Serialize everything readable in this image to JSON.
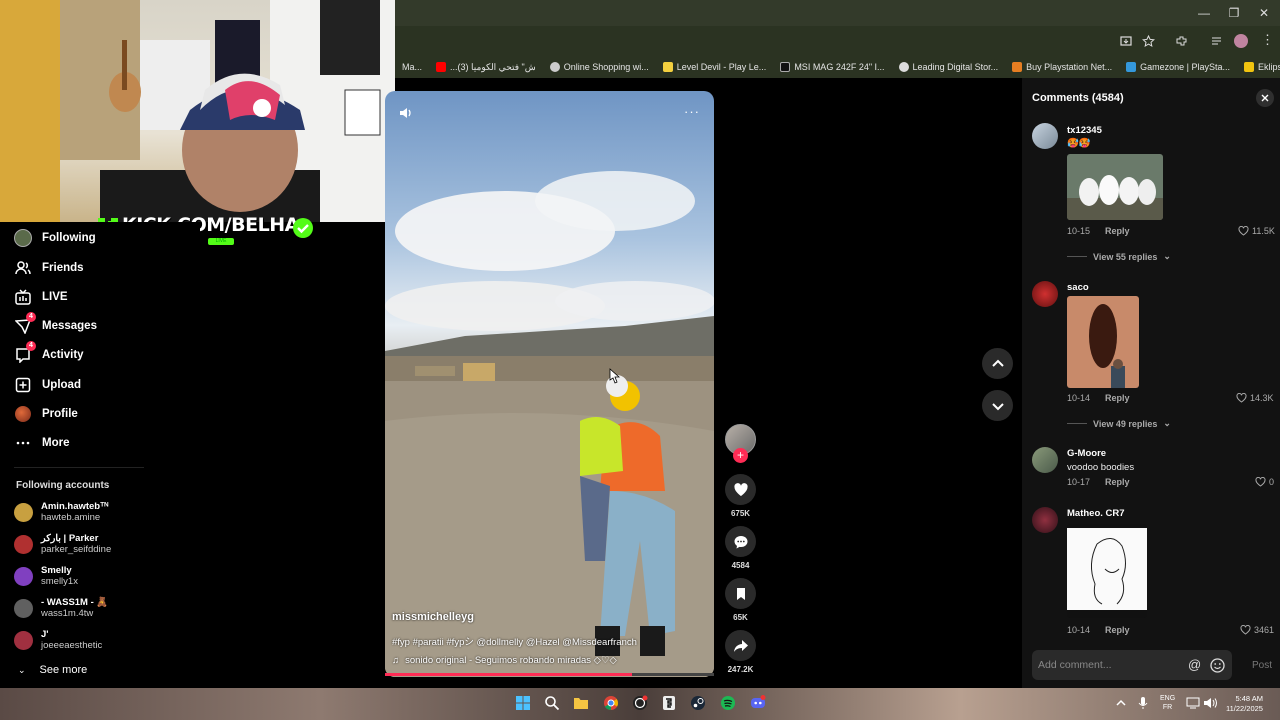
{
  "browser": {
    "bookmarks": [
      {
        "label": "Ma...",
        "color": "#888888"
      },
      {
        "label": "...ش\" فتحي الكوميا (3)",
        "color": "#ff0000"
      },
      {
        "label": "Online Shopping wi...",
        "color": "#cccccc"
      },
      {
        "label": "Level Devil - Play Le...",
        "color": "#f4d03f"
      },
      {
        "label": "MSI MAG 242F 24\" I...",
        "color": "#222222"
      },
      {
        "label": "Leading Digital Stor...",
        "color": "#dddddd"
      },
      {
        "label": "Buy Playstation Net...",
        "color": "#e67e22"
      },
      {
        "label": "Gamezone | PlaySta...",
        "color": "#3498db"
      },
      {
        "label": "Eklipse - Convert Tw...",
        "color": "#f1c40f"
      }
    ]
  },
  "stream_overlay": {
    "kick_text": "KICK.COM/BELHA",
    "live_label": "LIVE"
  },
  "sidebar": {
    "items": [
      {
        "label": "Following",
        "icon": "following-avatar-icon"
      },
      {
        "label": "Friends",
        "icon": "friends-icon"
      },
      {
        "label": "LIVE",
        "icon": "live-icon"
      },
      {
        "label": "Messages",
        "icon": "messages-icon",
        "badge": "4"
      },
      {
        "label": "Activity",
        "icon": "activity-icon",
        "badge": "4"
      },
      {
        "label": "Upload",
        "icon": "upload-icon"
      },
      {
        "label": "Profile",
        "icon": "profile-icon"
      },
      {
        "label": "More",
        "icon": "more-icon"
      }
    ],
    "following_header": "Following accounts",
    "accounts": [
      {
        "name": "Amin.hawtebᵀᴺ",
        "handle": "hawteb.amine",
        "color": "#c8a040"
      },
      {
        "name": "باركر | Parker",
        "handle": "parker_seifddine",
        "color": "#b03030"
      },
      {
        "name": "Smelly",
        "handle": "smelly1x",
        "color": "#8040c0"
      },
      {
        "name": "- WASS1M - 🧸",
        "handle": "wass1m.4tw",
        "color": "#606060"
      },
      {
        "name": "J'",
        "handle": "joeeeaesthetic",
        "color": "#a03040"
      }
    ],
    "see_more": "See more"
  },
  "video": {
    "author": "missmichelleyg",
    "caption": "#fyp #paratii #fypシ @dollmelly @Hazel @Missdearfranch",
    "music": "sonido original - Seguimos robando miradas ◇♡◇",
    "progress": 0.75,
    "actions": {
      "likes": "675K",
      "comments": "4584",
      "saves": "65K",
      "shares": "247.2K"
    }
  },
  "comments": {
    "title": "Comments (4584)",
    "items": [
      {
        "user": "tx12345",
        "text": "🥵🥵",
        "date": "10-15",
        "reply": "Reply",
        "likes": "11.5K",
        "view_replies": "View 55 replies",
        "avatar_color": "#8a9aaa"
      },
      {
        "user": "saco",
        "text": "",
        "date": "10-14",
        "reply": "Reply",
        "likes": "14.3K",
        "view_replies": "View 49 replies",
        "avatar_color": "#a02020"
      },
      {
        "user": "G-Moore",
        "text": "voodoo boodies",
        "date": "10-17",
        "reply": "Reply",
        "likes": "0",
        "view_replies": "",
        "avatar_color": "#708070"
      },
      {
        "user": "Matheo. CR7",
        "text": "",
        "date": "10-14",
        "reply": "Reply",
        "likes": "3461",
        "view_replies": "",
        "avatar_color": "#702030"
      }
    ],
    "add_placeholder": "Add comment...",
    "post_label": "Post"
  },
  "taskbar": {
    "lang_1": "ENG",
    "lang_2": "FR",
    "time": "5:48 AM",
    "date": "11/22/2025"
  }
}
